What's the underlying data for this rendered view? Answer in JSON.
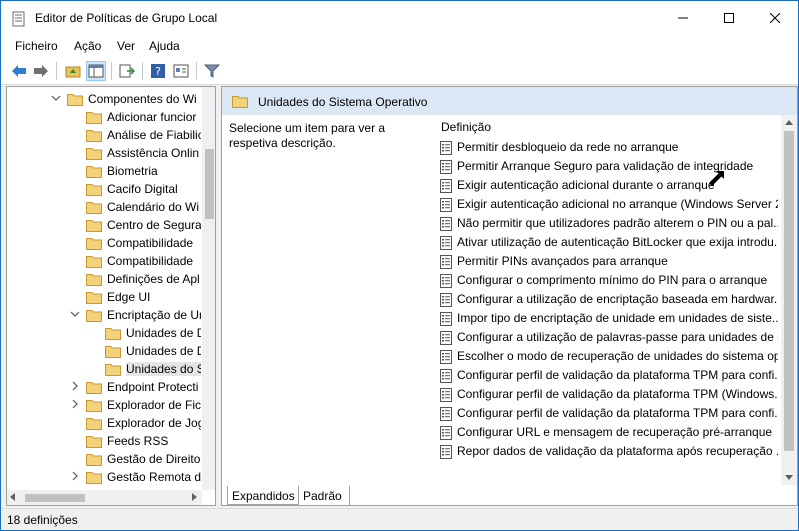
{
  "window": {
    "title": "Editor de Políticas de Grupo Local"
  },
  "menu": [
    "Ficheiro",
    "Ação",
    "Ver",
    "Ajuda"
  ],
  "toolbar": {
    "buttons": [
      "back-icon",
      "forward-icon",
      "up-folder-icon",
      "show-hide-tree-icon",
      "export-list-icon",
      "help-icon",
      "properties-view-icon",
      "filter-icon"
    ]
  },
  "tree": {
    "items": [
      {
        "label": "Componentes do Wi",
        "expanded": true
      },
      {
        "label": "Adicionar funcior"
      },
      {
        "label": "Análise de Fiabilic"
      },
      {
        "label": "Assistência Onlin"
      },
      {
        "label": "Biometria"
      },
      {
        "label": "Cacifo Digital"
      },
      {
        "label": "Calendário do Wi"
      },
      {
        "label": "Centro de Segura"
      },
      {
        "label": "Compatibilidade"
      },
      {
        "label": "Compatibilidade"
      },
      {
        "label": "Definições de Apl"
      },
      {
        "label": "Edge UI"
      },
      {
        "label": "Encriptação de Ur",
        "expanded": true
      },
      {
        "label": "Unidades de D"
      },
      {
        "label": "Unidades de D"
      },
      {
        "label": "Unidades do S",
        "selected": true
      },
      {
        "label": "Endpoint Protecti",
        "collapsed": true
      },
      {
        "label": "Explorador de Fic",
        "collapsed": true
      },
      {
        "label": "Explorador de Jog"
      },
      {
        "label": "Feeds RSS"
      },
      {
        "label": "Gestão de Direitos"
      },
      {
        "label": "Gestão Remota d",
        "collapsed": true
      }
    ]
  },
  "right": {
    "header": "Unidades do Sistema Operativo",
    "description": "Selecione um item para ver a respetiva descrição.",
    "column": "Definição",
    "policies": [
      "Permitir desbloqueio da rede no arranque",
      "Permitir Arranque Seguro para validação de integridade",
      "Exigir autenticação adicional durante o arranque",
      "Exigir autenticação adicional no arranque (Windows Server 2...",
      "Não permitir que utilizadores padrão alterem o PIN ou a pal...",
      "Ativar utilização de autenticação BitLocker que exija introdu...",
      "Permitir PINs avançados para arranque",
      "Configurar o comprimento mínimo do PIN para o arranque",
      "Configurar a utilização de encriptação baseada em hardwar...",
      "Impor tipo de encriptação de unidade em unidades de siste...",
      "Configurar a utilização de palavras-passe para unidades de s...",
      "Escolher o modo de recuperação de unidades do sistema op...",
      "Configurar perfil de validação da plataforma TPM para confi...",
      "Configurar perfil de validação da plataforma TPM (Windows...",
      "Configurar perfil de validação da plataforma TPM para confi...",
      "Configurar URL e mensagem de recuperação pré-arranque",
      "Repor dados de validação da plataforma após recuperação ..."
    ]
  },
  "tabs": [
    "Expandidos",
    "Padrão"
  ],
  "status": "18 definições",
  "colors": {
    "header_bg": "#dbe7f4",
    "folder": "#e8c25a",
    "accent": "#1b6ec2"
  }
}
